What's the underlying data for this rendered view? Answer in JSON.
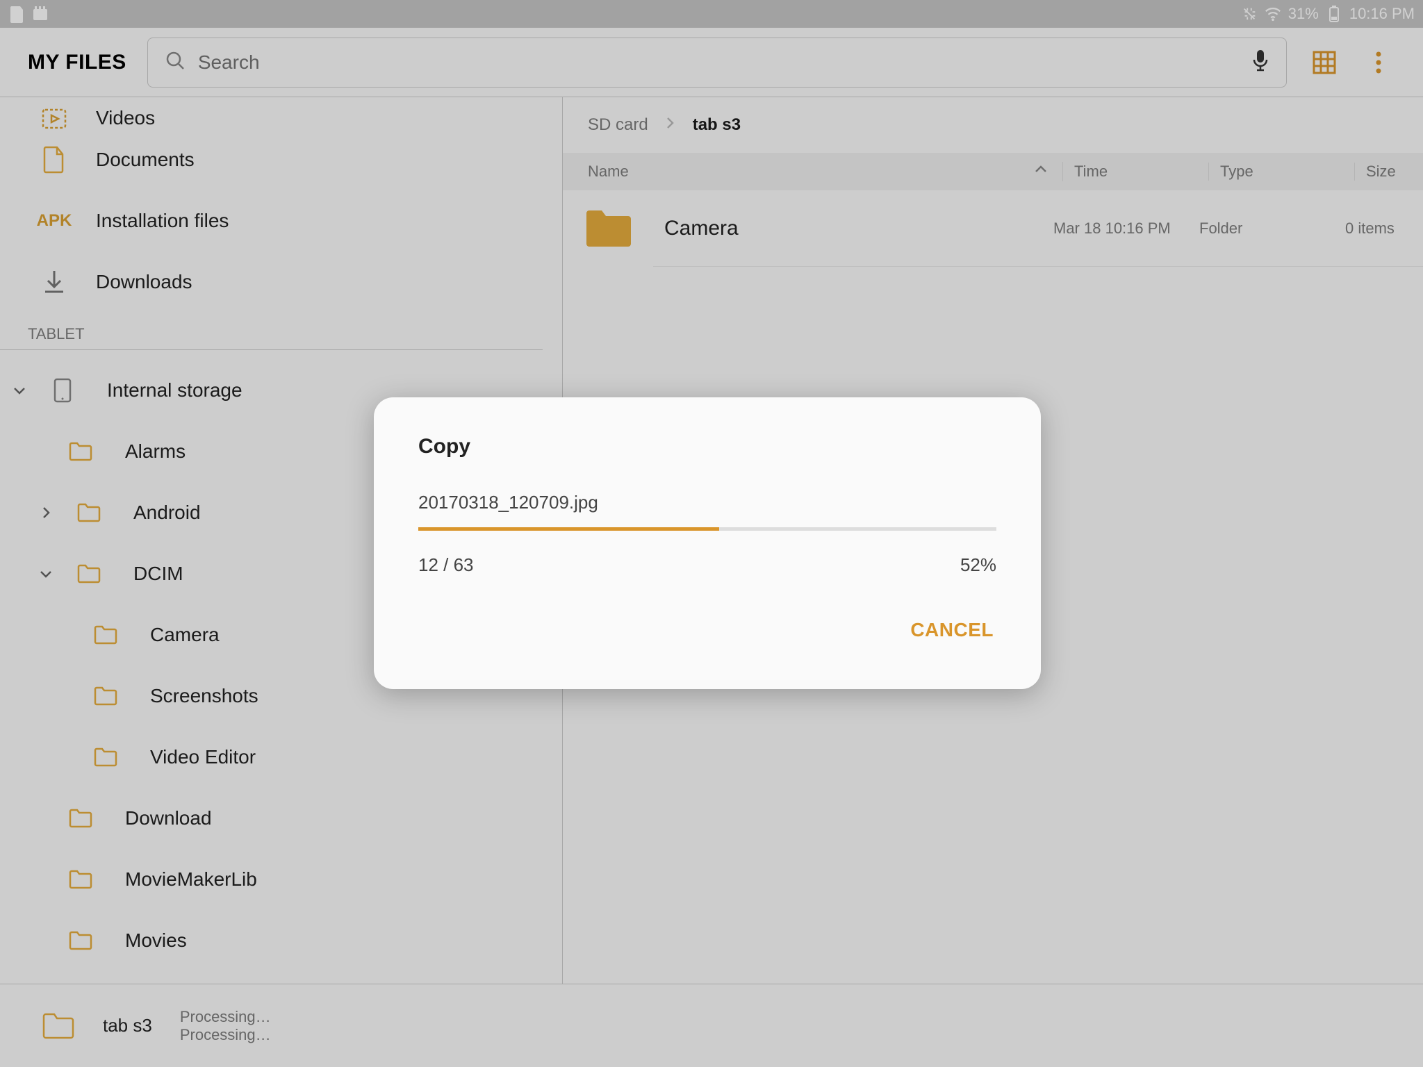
{
  "status_bar": {
    "battery_text": "31%",
    "time": "10:16 PM"
  },
  "app_bar": {
    "title": "MY FILES",
    "search_placeholder": "Search"
  },
  "sidebar": {
    "categories": {
      "videos": "Videos",
      "documents": "Documents",
      "installation_files": "Installation files",
      "apk_badge": "APK",
      "downloads": "Downloads"
    },
    "section_label": "TABLET",
    "tree": {
      "internal_storage": "Internal storage",
      "alarms": "Alarms",
      "android": "Android",
      "dcim": "DCIM",
      "camera": "Camera",
      "screenshots": "Screenshots",
      "video_editor": "Video Editor",
      "download": "Download",
      "moviemakerlib": "MovieMakerLib",
      "movies": "Movies"
    }
  },
  "breadcrumb": {
    "root": "SD card",
    "current": "tab s3"
  },
  "columns": {
    "name": "Name",
    "time": "Time",
    "type": "Type",
    "size": "Size"
  },
  "rows": [
    {
      "name": "Camera",
      "time": "Mar 18 10:16 PM",
      "type": "Folder",
      "size": "0 items"
    }
  ],
  "bottom": {
    "dest": "tab s3",
    "line1": "Processing…",
    "line2": "Processing…"
  },
  "modal": {
    "title": "Copy",
    "filename": "20170318_120709.jpg",
    "count": "12 / 63",
    "percent_text": "52%",
    "percent_value": 52,
    "cancel": "CANCEL"
  }
}
